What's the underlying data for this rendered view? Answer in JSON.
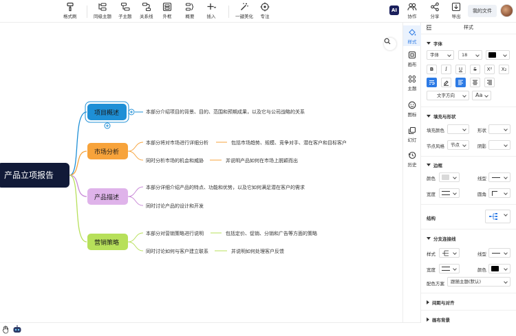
{
  "toolbar": {
    "format_brush": "格式刷",
    "sibling_topic": "同级主题",
    "child_topic": "子主题",
    "relation_line": "关系线",
    "frame": "外框",
    "summary": "概要",
    "insert": "插入",
    "beautify": "一键美化",
    "focus": "专注",
    "ai": "AI",
    "collab": "协作",
    "share": "分享",
    "export": "导出",
    "my_files": "我的文件"
  },
  "mindmap": {
    "root": "产品立项报告",
    "branches": [
      {
        "label": "项目概述",
        "color": "#1e8fd6",
        "details": [
          "本部分介绍项目的背景、目的、范围和预期成果，以及它与公司战略的关系"
        ]
      },
      {
        "label": "市场分析",
        "color": "#f7a33b",
        "details": [
          "本部分将对市场进行详细分析",
          "包括市场趋势、规模、竞争对手、潜在客户和目标客户",
          "同时分析市场的机会和威胁",
          "并说明产品如何在市场上脱颖而出"
        ]
      },
      {
        "label": "产品描述",
        "color": "#c989d8",
        "details": [
          "本部分详细介绍产品的特点、功能和优势，以及它如何满足潜在客户的需求",
          "同时讨论产品的设计和开发"
        ]
      },
      {
        "label": "营销策略",
        "color": "#b7e05a",
        "details": [
          "本部分对营销策略进行说明",
          "包括定价、促销、分销和广告等方面的策略",
          "同时讨论如何与客户建立联系",
          "并说明如何处理客户反馈"
        ]
      }
    ]
  },
  "sidebar": {
    "items": [
      {
        "label": "样式"
      },
      {
        "label": "画布"
      },
      {
        "label": "主题"
      },
      {
        "label": "图标"
      },
      {
        "label": "幻灯"
      },
      {
        "label": "历史"
      }
    ]
  },
  "panel": {
    "title": "样式",
    "font_section": "字体",
    "font_family": "字体",
    "font_size": "18",
    "text_direction": "文字方向",
    "fill_section": "填充与形状",
    "fill_color_label": "填充颜色",
    "shape_label": "形状",
    "node_style_label": "节点风格",
    "node_style_value": "节点",
    "shadow_label": "阴影",
    "border_section": "边框",
    "color_label": "颜色",
    "line_type_label": "线型",
    "width_label": "宽度",
    "corner_label": "圆角",
    "structure_label": "结构",
    "branch_section": "分支连接线",
    "style_label": "样式",
    "branch_line_type_label": "线型",
    "branch_width_label": "宽度",
    "branch_color_label": "颜色",
    "color_scheme_label": "配色方案",
    "color_scheme_value": "跟随主题(默认)",
    "spacing_section": "间距与对齐",
    "canvas_bg_section": "画布背景"
  }
}
